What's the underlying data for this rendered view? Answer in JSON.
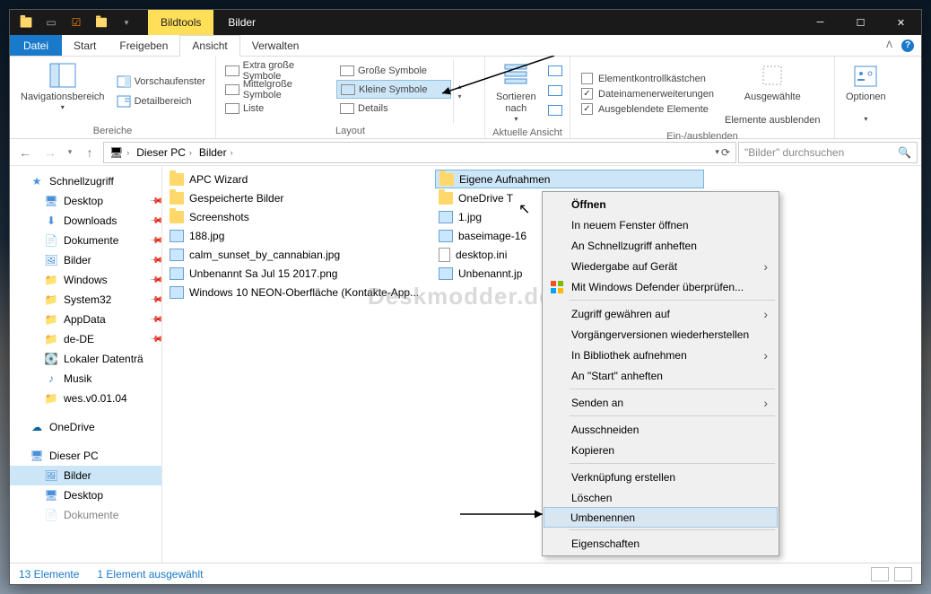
{
  "titlebar": {
    "context_tab": "Bildtools",
    "title": "Bilder"
  },
  "menubar": {
    "file": "Datei",
    "items": [
      "Start",
      "Freigeben",
      "Ansicht"
    ],
    "manage": "Verwalten",
    "active_index": 2
  },
  "ribbon": {
    "panes": {
      "label": "Bereiche",
      "nav": "Navigationsbereich",
      "preview": "Vorschaufenster",
      "detail": "Detailbereich"
    },
    "layout": {
      "label": "Layout",
      "items": [
        "Extra große Symbole",
        "Große Symbole",
        "Mittelgroße Symbole",
        "Kleine Symbole",
        "Liste",
        "Details"
      ],
      "selected": "Kleine Symbole"
    },
    "current_view": {
      "label": "Aktuelle Ansicht",
      "sort": "Sortieren nach"
    },
    "showhide": {
      "label": "Ein-/ausblenden",
      "items": [
        {
          "label": "Elementkontrollkästchen",
          "checked": false
        },
        {
          "label": "Dateinamenerweiterungen",
          "checked": true
        },
        {
          "label": "Ausgeblendete Elemente",
          "checked": true
        }
      ],
      "hide_btn_l1": "Ausgewählte",
      "hide_btn_l2": "Elemente ausblenden"
    },
    "options": "Optionen"
  },
  "addressbar": {
    "crumbs": [
      "Dieser PC",
      "Bilder"
    ],
    "search_placeholder": "\"Bilder\" durchsuchen"
  },
  "sidebar": {
    "quick_access": "Schnellzugriff",
    "items_pinned": [
      "Desktop",
      "Downloads",
      "Dokumente",
      "Bilder",
      "Windows",
      "System32",
      "AppData",
      "de-DE"
    ],
    "items_unpinned": [
      "Lokaler Datenträ",
      "Musik",
      "wes.v0.01.04"
    ],
    "onedrive": "OneDrive",
    "this_pc": "Dieser PC",
    "this_pc_children": [
      "Bilder",
      "Desktop",
      "Dokumente"
    ],
    "selected": "Bilder"
  },
  "files": {
    "col1": [
      {
        "type": "folder",
        "name": "APC Wizard"
      },
      {
        "type": "folder",
        "name": "Gespeicherte Bilder"
      },
      {
        "type": "folder",
        "name": "Screenshots"
      },
      {
        "type": "image",
        "name": "188.jpg"
      },
      {
        "type": "image",
        "name": "calm_sunset_by_cannabian.jpg"
      },
      {
        "type": "image",
        "name": "Unbenannt Sa Jul 15 2017.png"
      },
      {
        "type": "image",
        "name": "Windows 10 NEON-Oberfläche (Kontakte-App..."
      }
    ],
    "col2": [
      {
        "type": "folder",
        "name": "Eigene Aufnahmen",
        "selected": true
      },
      {
        "type": "folder",
        "name": "OneDrive T"
      },
      {
        "type": "image",
        "name": "1.jpg"
      },
      {
        "type": "image",
        "name": "baseimage-16"
      },
      {
        "type": "file",
        "name": "desktop.ini"
      },
      {
        "type": "image",
        "name": "Unbenannt.jp"
      }
    ]
  },
  "context_menu": {
    "items": [
      {
        "label": "Öffnen",
        "bold": true
      },
      {
        "label": "In neuem Fenster öffnen"
      },
      {
        "label": "An Schnellzugriff anheften"
      },
      {
        "label": "Wiedergabe auf Gerät",
        "sub": true
      },
      {
        "label": "Mit Windows Defender überprüfen...",
        "icon": "defender"
      },
      {
        "sep": true
      },
      {
        "label": "Zugriff gewähren auf",
        "sub": true
      },
      {
        "label": "Vorgängerversionen wiederherstellen"
      },
      {
        "label": "In Bibliothek aufnehmen",
        "sub": true
      },
      {
        "label": "An \"Start\" anheften"
      },
      {
        "sep": true
      },
      {
        "label": "Senden an",
        "sub": true
      },
      {
        "sep": true
      },
      {
        "label": "Ausschneiden"
      },
      {
        "label": "Kopieren"
      },
      {
        "sep": true
      },
      {
        "label": "Verknüpfung erstellen"
      },
      {
        "label": "Löschen"
      },
      {
        "label": "Umbenennen",
        "hover": true
      },
      {
        "sep": true
      },
      {
        "label": "Eigenschaften"
      }
    ]
  },
  "statusbar": {
    "count": "13 Elemente",
    "selection": "1 Element ausgewählt"
  },
  "watermark": "Deskmodder.de"
}
